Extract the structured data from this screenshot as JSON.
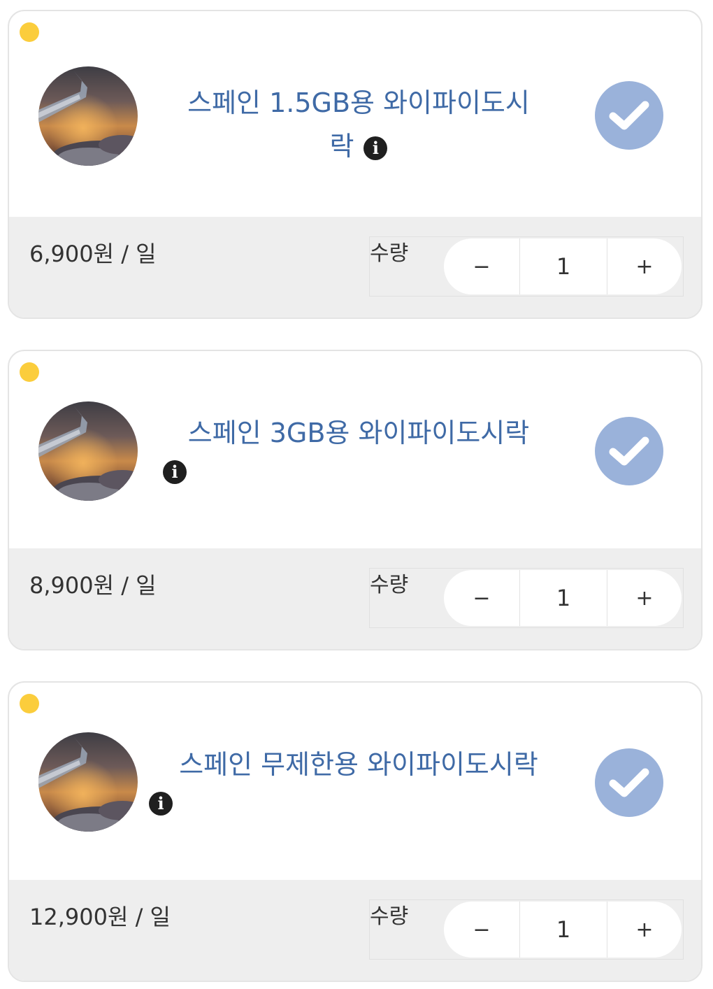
{
  "colors": {
    "title": "#3f6aa6",
    "dot": "#fbcd3c",
    "check_button": "#9ab2da",
    "footer_bg": "#eeeeee"
  },
  "products": [
    {
      "title": "스페인 1.5GB용 와이파이도시",
      "title_wrap": "락",
      "price": "6,900원 / 일",
      "quantity_label": "수량",
      "quantity": "1",
      "minus": "−",
      "plus": "+",
      "info_icon": "info-icon",
      "selected": true
    },
    {
      "title": "스페인 3GB용 와이파이도시락",
      "price": "8,900원 / 일",
      "quantity_label": "수량",
      "quantity": "1",
      "minus": "−",
      "plus": "+",
      "info_icon": "info-icon",
      "selected": true
    },
    {
      "title": "스페인 무제한용 와이파이도시락",
      "price": "12,900원 / 일",
      "quantity_label": "수량",
      "quantity": "1",
      "minus": "−",
      "plus": "+",
      "info_icon": "info-icon",
      "selected": true
    }
  ]
}
